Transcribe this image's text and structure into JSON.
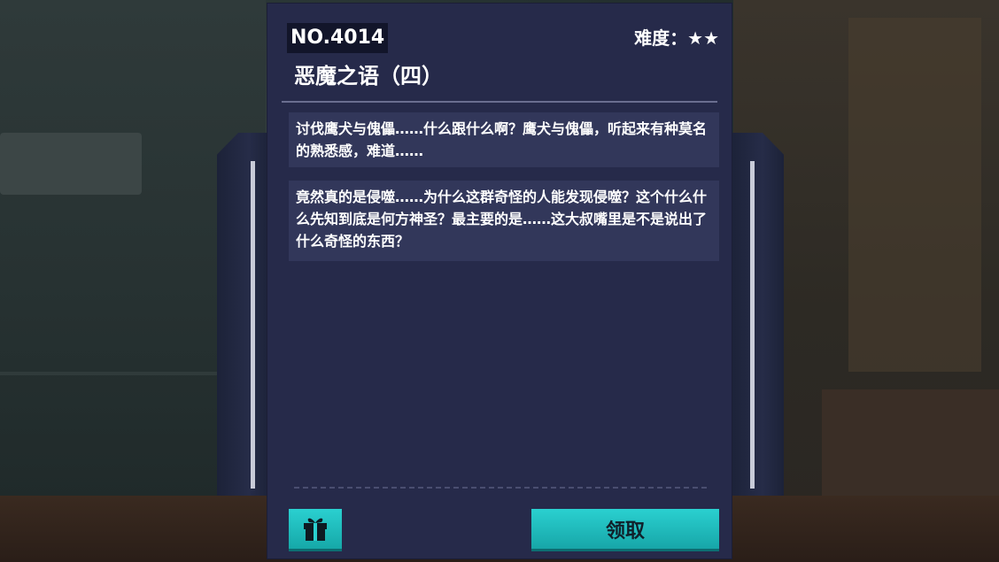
{
  "card": {
    "number": "NO.4014",
    "difficulty_label": "难度：",
    "difficulty_stars": "★★",
    "title": "恶魔之语（四）",
    "messages": [
      "讨伐鹰犬与傀儡……什么跟什么啊？鹰犬与傀儡，听起来有种莫名的熟悉感，难道……",
      "竟然真的是侵噬……为什么这群奇怪的人能发现侵噬？这个什么什么先知到底是何方神圣？最主要的是……这大叔嘴里是不是说出了什么奇怪的东西？"
    ]
  },
  "actions": {
    "gift_icon": "gift-icon",
    "claim_label": "领取"
  },
  "colors": {
    "card_bg": "#262a4a",
    "message_bg": "#32375a",
    "button_teal": "#1fbcbe"
  }
}
